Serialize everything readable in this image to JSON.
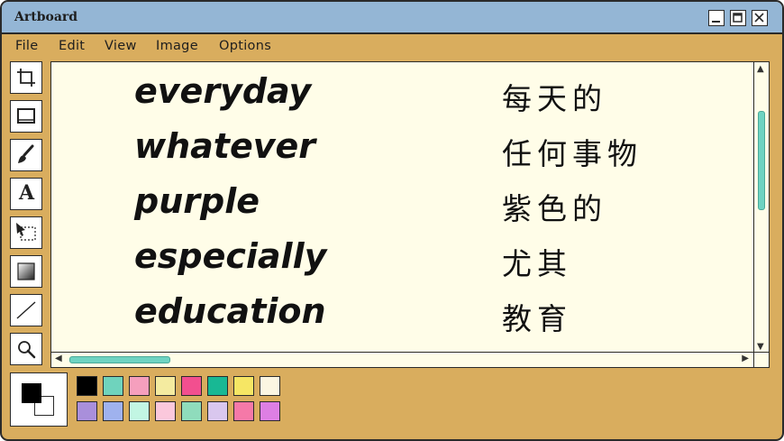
{
  "window": {
    "title": "Artboard"
  },
  "menu": [
    "File",
    "Edit",
    "View",
    "Image",
    "Options"
  ],
  "tools": [
    {
      "name": "crop-icon"
    },
    {
      "name": "rectangle-icon"
    },
    {
      "name": "brush-icon"
    },
    {
      "name": "text-icon",
      "glyph": "A"
    },
    {
      "name": "select-icon"
    },
    {
      "name": "gradient-icon"
    },
    {
      "name": "line-icon"
    },
    {
      "name": "zoom-icon"
    }
  ],
  "vocab": [
    {
      "en": "everyday",
      "zh": "每天的"
    },
    {
      "en": "whatever",
      "zh": "任何事物"
    },
    {
      "en": "purple",
      "zh": "紫色的"
    },
    {
      "en": "especially",
      "zh": "尤其"
    },
    {
      "en": "education",
      "zh": "教育"
    }
  ],
  "colors": {
    "foreground": "#000000",
    "background": "#ffffff",
    "palette_row1": [
      "#000000",
      "#6fd3bd",
      "#f59fbd",
      "#f4eba0",
      "#f24f8f",
      "#18b894",
      "#f6e664",
      "#fbf6e2"
    ],
    "palette_row2": [
      "#a98fdb",
      "#9fb2ee",
      "#c2f6e3",
      "#fbc8dc",
      "#8fdcbc",
      "#d9c7ee",
      "#f579a8",
      "#dd7fe4"
    ]
  }
}
